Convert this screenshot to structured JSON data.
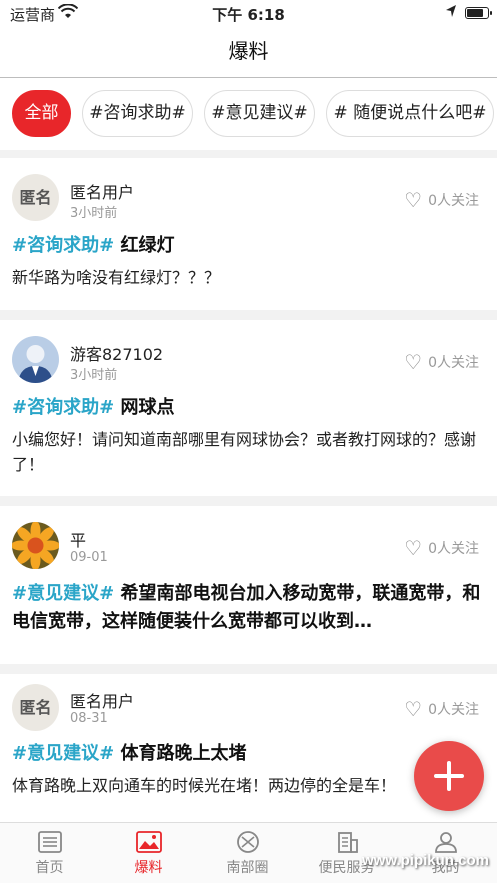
{
  "status_bar": {
    "carrier": "运营商",
    "time": "下午 6:18",
    "battery_level": 0.85
  },
  "header": {
    "title": "爆料"
  },
  "filters": [
    {
      "label": "全部",
      "active": true
    },
    {
      "label": "#咨询求助#",
      "active": false
    },
    {
      "label": "#意见建议#",
      "active": false
    },
    {
      "label": "# 随便说点什么吧#",
      "active": false
    }
  ],
  "posts": [
    {
      "avatar_text": "匿名",
      "user": "匿名用户",
      "time": "3小时前",
      "follow": "0人关注",
      "tag": "#咨询求助#",
      "title": " 红绿灯",
      "body": "新华路为啥没有红绿灯？？？"
    },
    {
      "avatar_text": "",
      "user": "游客827102",
      "time": "3小时前",
      "follow": "0人关注",
      "tag": "#咨询求助#",
      "title": " 网球点",
      "body": "小编您好！请问知道南部哪里有网球协会？或者教打网球的？感谢了！"
    },
    {
      "avatar_text": "",
      "user": "平",
      "time": "09-01",
      "follow": "0人关注",
      "tag": "#意见建议#",
      "title": " 希望南部电视台加入移动宽带，联通宽带，和电信宽带，这样随便装什么宽带都可以收到…",
      "body": ""
    },
    {
      "avatar_text": "匿名",
      "user": "匿名用户",
      "time": "08-31",
      "follow": "0人关注",
      "tag": "#意见建议#",
      "title": " 体育路晚上太堵",
      "body": "体育路晚上双向通车的时候光在堵！两边停的全是车！"
    }
  ],
  "tabbar": [
    {
      "label": "首页",
      "icon": "home-icon",
      "active": false
    },
    {
      "label": "爆料",
      "icon": "image-icon",
      "active": true
    },
    {
      "label": "南部圈",
      "icon": "circle-icon",
      "active": false
    },
    {
      "label": "便民服务",
      "icon": "building-icon",
      "active": false
    },
    {
      "label": "我的",
      "icon": "user-icon",
      "active": false
    }
  ],
  "watermark": "www.pipikun.com",
  "colors": {
    "accent": "#e8262a",
    "tag": "#2aa5c8",
    "fab": "#e94b4a"
  }
}
